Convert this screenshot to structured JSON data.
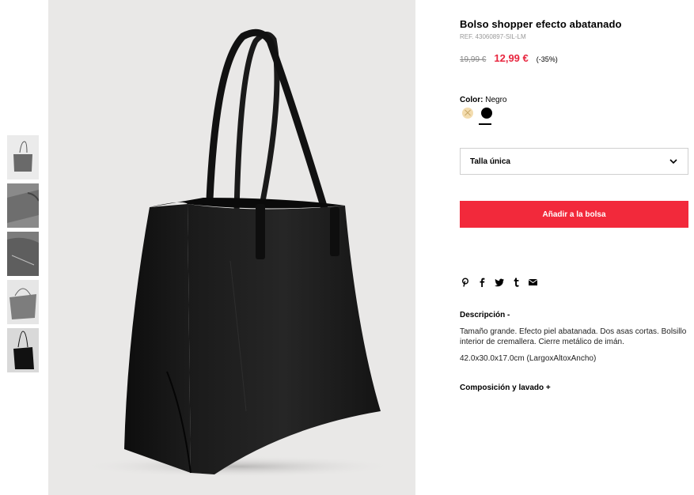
{
  "product": {
    "title": "Bolso shopper efecto abatanado",
    "ref": "REF. 43060897-SIL-LM",
    "old_price": "19,99 €",
    "new_price": "12,99 €",
    "discount": "(-35%)"
  },
  "color": {
    "label": "Color:",
    "value": "Negro",
    "swatches": [
      {
        "name": "beige",
        "hex": "#f3dcae",
        "available": false
      },
      {
        "name": "negro",
        "hex": "#000000",
        "selected": true
      }
    ]
  },
  "size": {
    "selected": "Talla única",
    "icon": "chevron-down-icon"
  },
  "cart": {
    "add_label": "Añadir a la bolsa",
    "accent": "#f2293b"
  },
  "share": [
    "pinterest-icon",
    "facebook-icon",
    "twitter-icon",
    "tumblr-icon",
    "email-icon"
  ],
  "description": {
    "title": "Descripción -",
    "text": "Tamaño grande. Efecto piel abatanada. Dos asas cortas. Bolsillo interior de cremallera. Cierre metálico de imán.",
    "dimensions": "42.0x30.0x17.0cm (LargoxAltoxAncho)"
  },
  "composition": {
    "title": "Composición y lavado +"
  },
  "colors": {
    "price_red": "#e8263f",
    "image_bg": "#e9e8e7"
  }
}
